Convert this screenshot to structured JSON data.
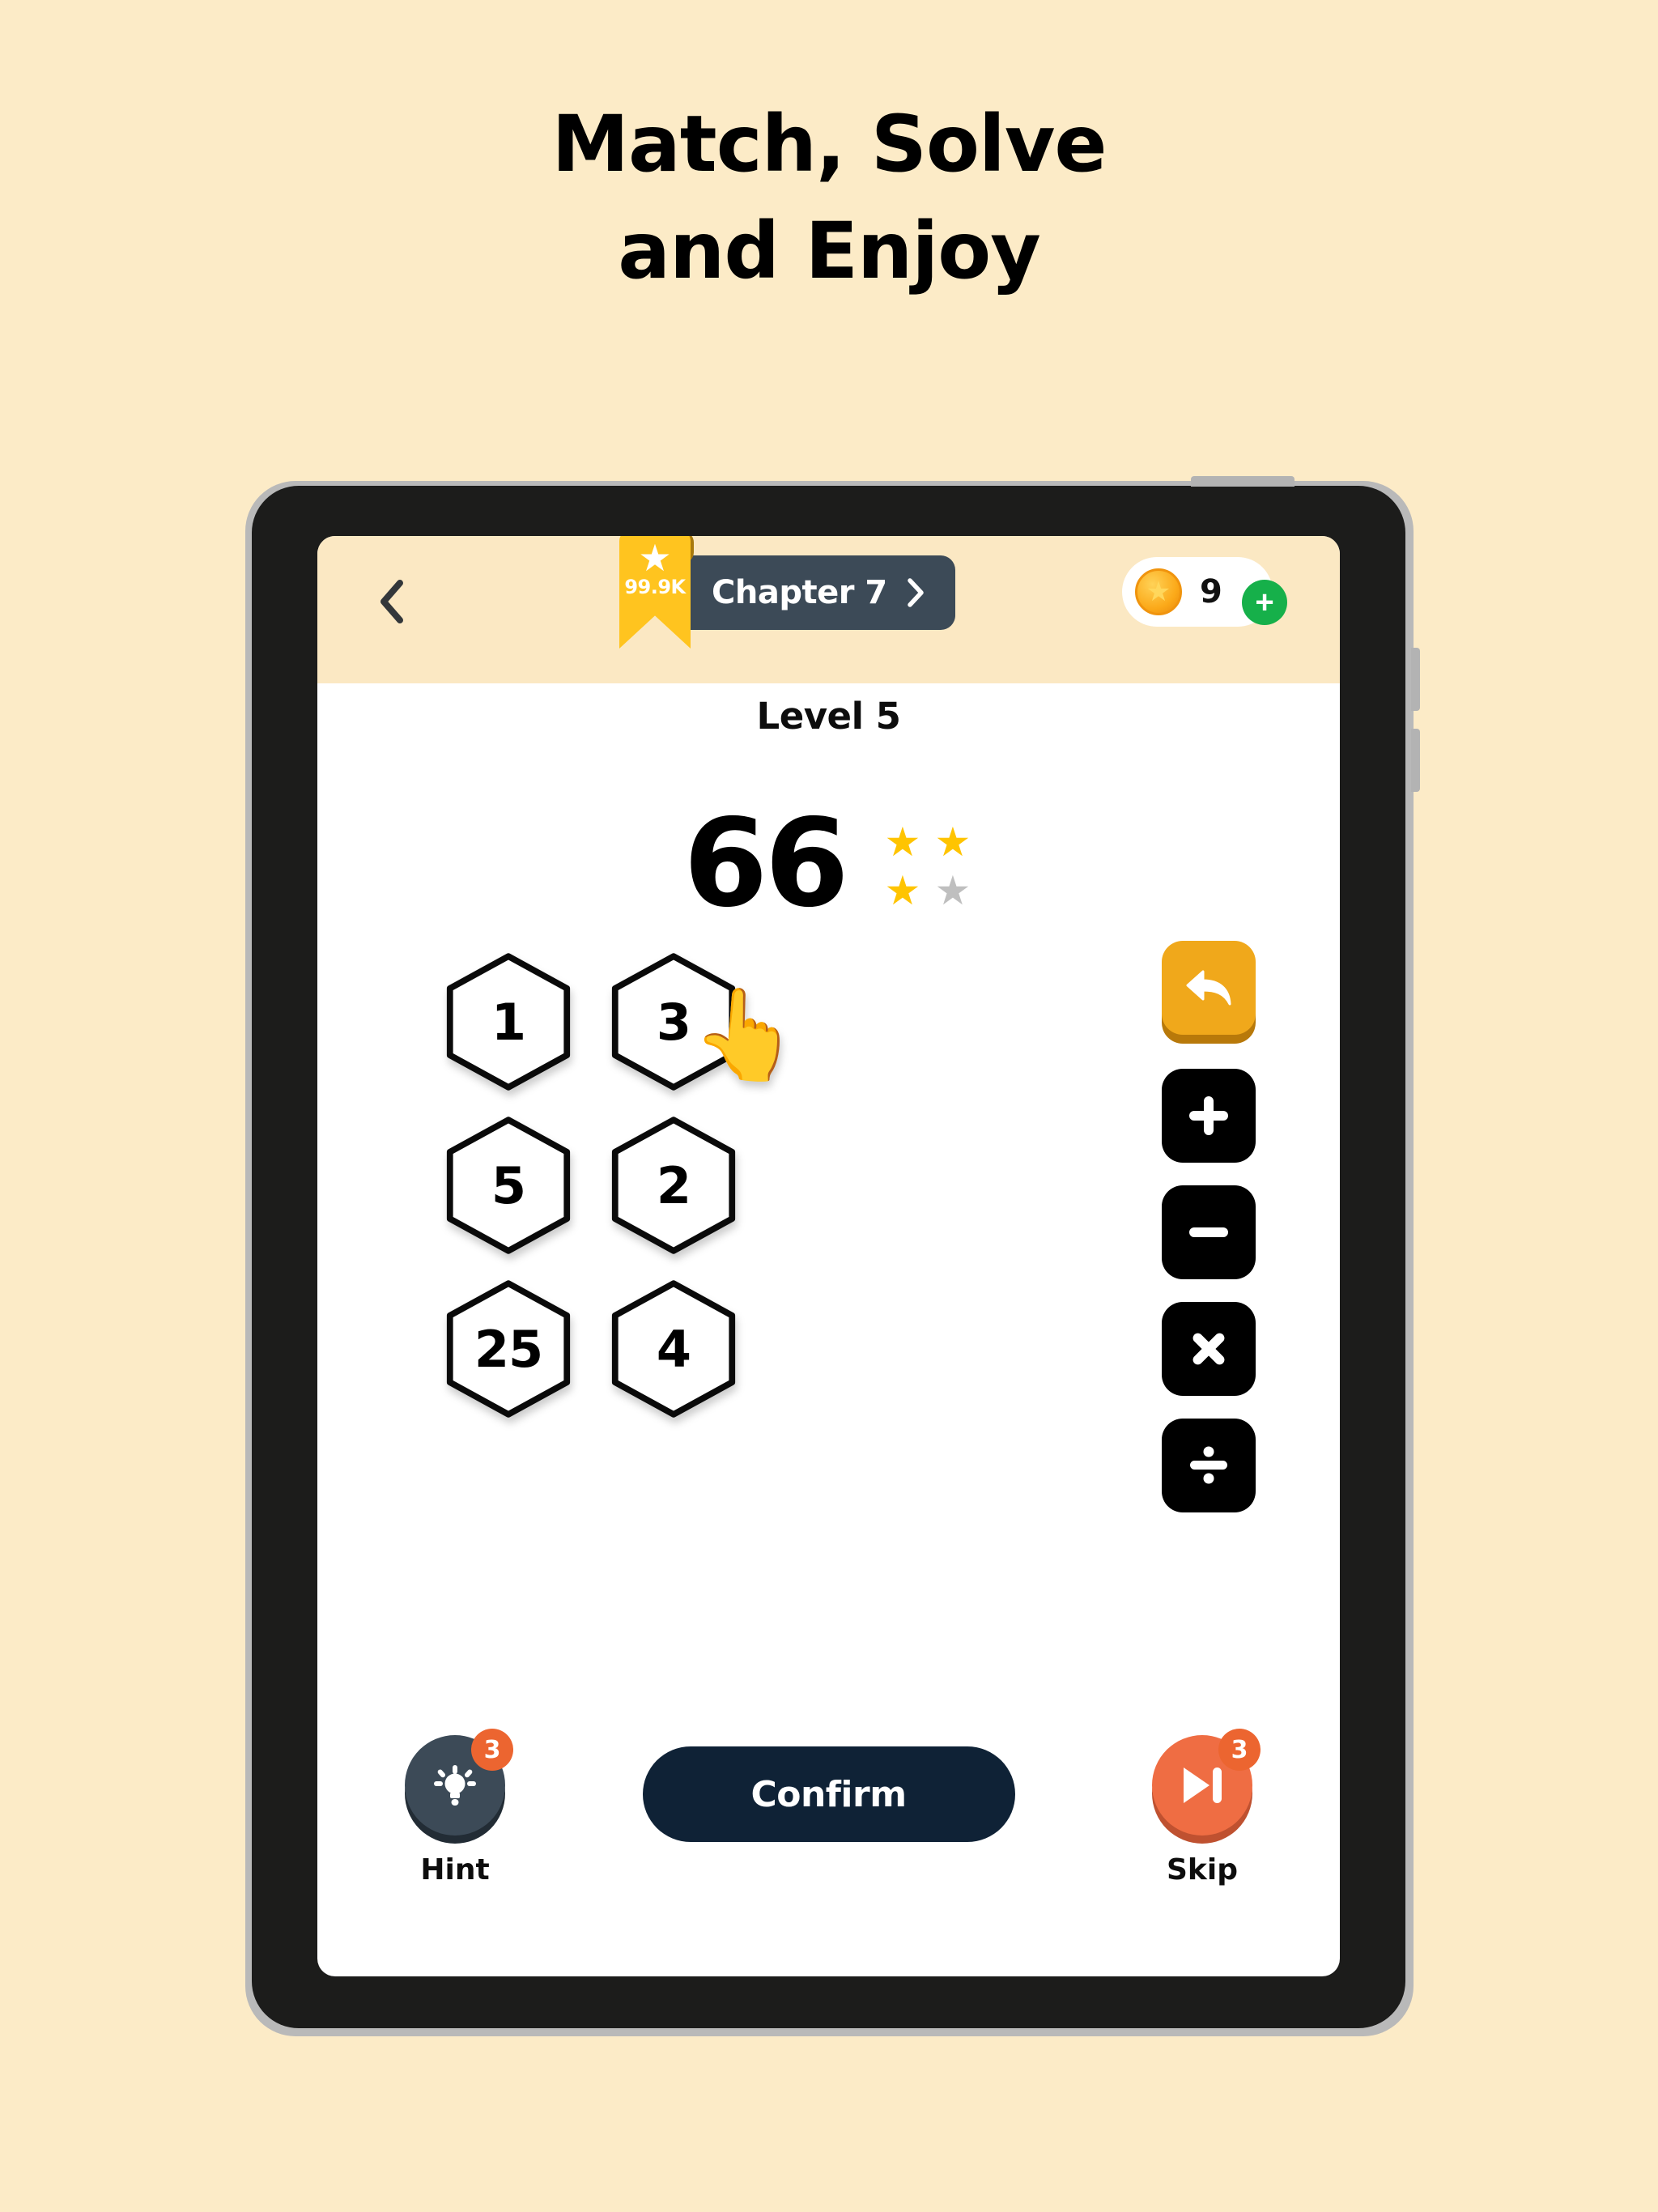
{
  "headline": {
    "line1": "Match, Solve",
    "line2": "and Enjoy"
  },
  "colors": {
    "background": "#FCEBC7",
    "header_band": "#FBE8C3",
    "chapter_pill": "#3C4A57",
    "ribbon_gold": "#FFC41F",
    "confirm_navy": "#0F2236",
    "skip_orange": "#EF6D43",
    "undo_orange": "#F0A81B",
    "star_on": "#FFC400",
    "star_off": "#BFBFBF",
    "coin_plus_green": "#16B04A",
    "badge_orange": "#EC6530"
  },
  "header": {
    "back_icon": "chevron-left-icon",
    "ribbon": {
      "icon": "star-icon",
      "star_glyph": "★",
      "count": "99.9K"
    },
    "chapter": {
      "label": "Chapter 7",
      "chevron_icon": "chevron-right-icon"
    },
    "coins": {
      "icon": "coin-icon",
      "glyph": "★",
      "amount": "9",
      "add_label": "+"
    }
  },
  "level": {
    "title": "Level 5",
    "target": "66",
    "stars": [
      {
        "state": "on",
        "glyph": "★"
      },
      {
        "state": "on",
        "glyph": "★"
      },
      {
        "state": "on",
        "glyph": "★"
      },
      {
        "state": "off",
        "glyph": "★"
      }
    ]
  },
  "board": {
    "tiles": [
      {
        "value": "1",
        "selected": false
      },
      {
        "value": "3",
        "selected": true
      },
      {
        "value": "5",
        "selected": false
      },
      {
        "value": "2",
        "selected": false
      },
      {
        "value": "25",
        "selected": false
      },
      {
        "value": "4",
        "selected": false
      }
    ],
    "cursor": {
      "icon": "pointing-hand-cursor",
      "glyph": "👆"
    }
  },
  "operators": [
    {
      "name": "undo-button",
      "icon": "undo-arrow-icon",
      "symbol": "↩"
    },
    {
      "name": "plus-button",
      "icon": "plus-icon",
      "symbol": "+"
    },
    {
      "name": "minus-button",
      "icon": "minus-icon",
      "symbol": "−"
    },
    {
      "name": "multiply-button",
      "icon": "multiply-icon",
      "symbol": "×"
    },
    {
      "name": "divide-button",
      "icon": "divide-icon",
      "symbol": "÷"
    }
  ],
  "footer": {
    "hint": {
      "label": "Hint",
      "count": "3",
      "icon": "lightbulb-icon"
    },
    "confirm": {
      "label": "Confirm"
    },
    "skip": {
      "label": "Skip",
      "count": "3",
      "icon": "skip-next-icon"
    }
  }
}
